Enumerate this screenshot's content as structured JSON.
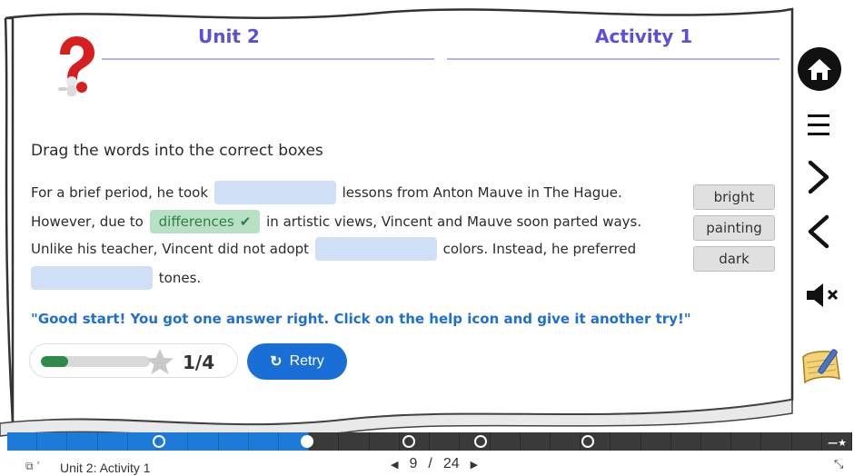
{
  "header": {
    "unit": "Unit 2",
    "activity": "Activity 1"
  },
  "icons": {
    "help": "help-question-icon",
    "home": "home-icon",
    "menu": "menu-icon",
    "next": "chevron-right-icon",
    "prev": "chevron-left-icon",
    "mute": "speaker-mute-icon",
    "notes": "notepad-icon",
    "retry": "retry-icon",
    "star": "star-icon",
    "screen": "screens-icon",
    "expand": "expand-icon"
  },
  "instruction": "Drag the words into the correct boxes",
  "passage": {
    "l1_a": "For a brief period, he took",
    "l1_b": "lessons from Anton Mauve in The Hague.",
    "l2_a": "However, due to",
    "l2_filled": "differences",
    "l2_check": "✔",
    "l2_b": "in artistic views, Vincent and Mauve soon parted ways.",
    "l3_a": "Unlike his teacher, Vincent did not adopt",
    "l3_b": "colors. Instead, he preferred",
    "l4_b": "tones."
  },
  "word_bank": [
    "bright",
    "painting",
    "dark"
  ],
  "feedback": "\"Good start! You got one answer right. Click on the help icon and give it another try!\"",
  "score": {
    "text": "1/4",
    "fraction": 0.25
  },
  "retry_label": "Retry",
  "colors": {
    "accent": "#5a4fd8",
    "button": "#1a6fd6",
    "correct": "#2e8a4a",
    "drop": "#cfe0f6"
  },
  "strip": {
    "segments": 28,
    "done": 10,
    "markers": [
      0.18,
      0.355,
      0.475,
      0.56,
      0.687
    ]
  },
  "footer": {
    "title": "Unit 2: Activity 1",
    "page_current": "9",
    "page_total": "24",
    "page_sep": "/"
  }
}
